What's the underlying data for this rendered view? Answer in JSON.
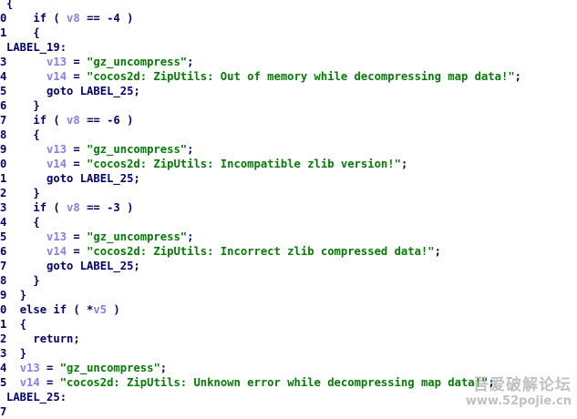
{
  "colors": {
    "background": "#ffffff",
    "keyword": "#000080",
    "variable": "#8080ff",
    "string": "#008000"
  },
  "lines": [
    {
      "gutter": "",
      "indent": 0,
      "segments": [
        {
          "t": "norm",
          "v": "{"
        }
      ]
    },
    {
      "gutter": "0",
      "indent": 2,
      "segments": [
        {
          "t": "norm",
          "v": "if ( "
        },
        {
          "t": "var",
          "v": "v8"
        },
        {
          "t": "norm",
          "v": " == -4 )"
        }
      ]
    },
    {
      "gutter": "1",
      "indent": 2,
      "segments": [
        {
          "t": "norm",
          "v": "{"
        }
      ]
    },
    {
      "gutter": "",
      "indent": 0,
      "segments": [
        {
          "t": "norm",
          "v": "LABEL_19:"
        }
      ]
    },
    {
      "gutter": "3",
      "indent": 3,
      "segments": [
        {
          "t": "var",
          "v": "v13"
        },
        {
          "t": "norm",
          "v": " = "
        },
        {
          "t": "str",
          "v": "\"gz_uncompress\""
        },
        {
          "t": "norm",
          "v": ";"
        }
      ]
    },
    {
      "gutter": "4",
      "indent": 3,
      "segments": [
        {
          "t": "var",
          "v": "v14"
        },
        {
          "t": "norm",
          "v": " = "
        },
        {
          "t": "str",
          "v": "\"cocos2d: ZipUtils: Out of memory while decompressing map data!\""
        },
        {
          "t": "norm",
          "v": ";"
        }
      ]
    },
    {
      "gutter": "5",
      "indent": 3,
      "segments": [
        {
          "t": "norm",
          "v": "goto LABEL_25;"
        }
      ]
    },
    {
      "gutter": "6",
      "indent": 2,
      "segments": [
        {
          "t": "norm",
          "v": "}"
        }
      ]
    },
    {
      "gutter": "7",
      "indent": 2,
      "segments": [
        {
          "t": "norm",
          "v": "if ( "
        },
        {
          "t": "var",
          "v": "v8"
        },
        {
          "t": "norm",
          "v": " == -6 )"
        }
      ]
    },
    {
      "gutter": "8",
      "indent": 2,
      "segments": [
        {
          "t": "norm",
          "v": "{"
        }
      ]
    },
    {
      "gutter": "9",
      "indent": 3,
      "segments": [
        {
          "t": "var",
          "v": "v13"
        },
        {
          "t": "norm",
          "v": " = "
        },
        {
          "t": "str",
          "v": "\"gz_uncompress\""
        },
        {
          "t": "norm",
          "v": ";"
        }
      ]
    },
    {
      "gutter": "0",
      "indent": 3,
      "segments": [
        {
          "t": "var",
          "v": "v14"
        },
        {
          "t": "norm",
          "v": " = "
        },
        {
          "t": "str",
          "v": "\"cocos2d: ZipUtils: Incompatible zlib version!\""
        },
        {
          "t": "norm",
          "v": ";"
        }
      ]
    },
    {
      "gutter": "1",
      "indent": 3,
      "segments": [
        {
          "t": "norm",
          "v": "goto LABEL_25;"
        }
      ]
    },
    {
      "gutter": "2",
      "indent": 2,
      "segments": [
        {
          "t": "norm",
          "v": "}"
        }
      ]
    },
    {
      "gutter": "3",
      "indent": 2,
      "segments": [
        {
          "t": "norm",
          "v": "if ( "
        },
        {
          "t": "var",
          "v": "v8"
        },
        {
          "t": "norm",
          "v": " == -3 )"
        }
      ]
    },
    {
      "gutter": "4",
      "indent": 2,
      "segments": [
        {
          "t": "norm",
          "v": "{"
        }
      ]
    },
    {
      "gutter": "5",
      "indent": 3,
      "segments": [
        {
          "t": "var",
          "v": "v13"
        },
        {
          "t": "norm",
          "v": " = "
        },
        {
          "t": "str",
          "v": "\"gz_uncompress\""
        },
        {
          "t": "norm",
          "v": ";"
        }
      ]
    },
    {
      "gutter": "6",
      "indent": 3,
      "segments": [
        {
          "t": "var",
          "v": "v14"
        },
        {
          "t": "norm",
          "v": " = "
        },
        {
          "t": "str",
          "v": "\"cocos2d: ZipUtils: Incorrect zlib compressed data!\""
        },
        {
          "t": "norm",
          "v": ";"
        }
      ]
    },
    {
      "gutter": "7",
      "indent": 3,
      "segments": [
        {
          "t": "norm",
          "v": "goto LABEL_25;"
        }
      ]
    },
    {
      "gutter": "8",
      "indent": 2,
      "segments": [
        {
          "t": "norm",
          "v": "}"
        }
      ]
    },
    {
      "gutter": "9",
      "indent": 1,
      "segments": [
        {
          "t": "norm",
          "v": "}"
        }
      ]
    },
    {
      "gutter": "0",
      "indent": 1,
      "segments": [
        {
          "t": "norm",
          "v": "else if ( *"
        },
        {
          "t": "var",
          "v": "v5"
        },
        {
          "t": "norm",
          "v": " )"
        }
      ]
    },
    {
      "gutter": "1",
      "indent": 1,
      "segments": [
        {
          "t": "norm",
          "v": "{"
        }
      ]
    },
    {
      "gutter": "2",
      "indent": 2,
      "segments": [
        {
          "t": "norm",
          "v": "return;"
        }
      ]
    },
    {
      "gutter": "3",
      "indent": 1,
      "segments": [
        {
          "t": "norm",
          "v": "}"
        }
      ]
    },
    {
      "gutter": "4",
      "indent": 1,
      "segments": [
        {
          "t": "var",
          "v": "v13"
        },
        {
          "t": "norm",
          "v": " = "
        },
        {
          "t": "str",
          "v": "\"gz_uncompress\""
        },
        {
          "t": "norm",
          "v": ";"
        }
      ]
    },
    {
      "gutter": "5",
      "indent": 1,
      "segments": [
        {
          "t": "var",
          "v": "v14"
        },
        {
          "t": "norm",
          "v": " = "
        },
        {
          "t": "str",
          "v": "\"cocos2d: ZipUtils: Unknown error while decompressing map data!\""
        },
        {
          "t": "norm",
          "v": ";"
        }
      ]
    },
    {
      "gutter": "",
      "indent": 0,
      "segments": [
        {
          "t": "norm",
          "v": "LABEL_25:"
        }
      ]
    },
    {
      "gutter": "7",
      "indent": 0,
      "segments": []
    }
  ],
  "watermark": {
    "title": "吾爱破解论坛",
    "url": "www.52pojie.cn"
  }
}
